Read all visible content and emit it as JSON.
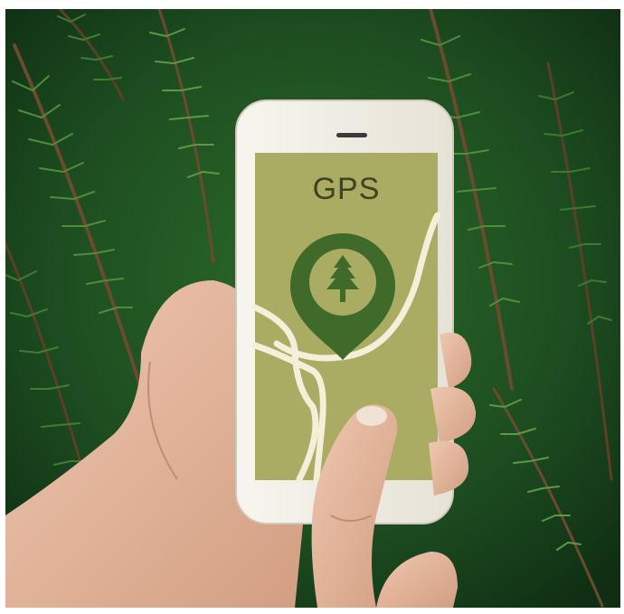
{
  "phone": {
    "app_title": "GPS",
    "pin_icon": "tree-icon"
  },
  "colors": {
    "foliage_dark": "#163d1b",
    "foliage_mid": "#2f6b2c",
    "foliage_light": "#5f9a45",
    "screen_bg": "#a9ac62",
    "pin": "#3f6a2a",
    "road": "#f3efd9",
    "skin": "#e0b49a"
  }
}
